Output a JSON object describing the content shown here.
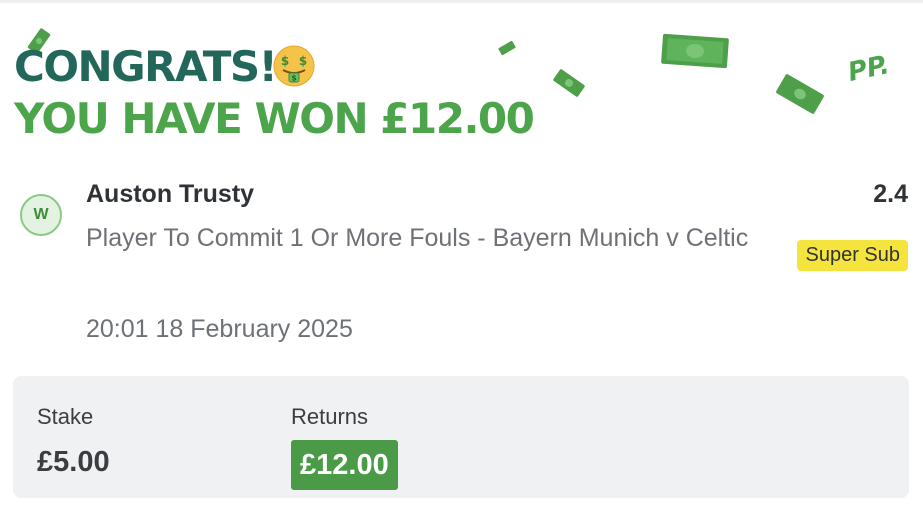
{
  "header": {
    "congrats_text": "CONGRATS!",
    "won_text": "YOU HAVE WON £12.00",
    "emoji_icon": "money-mouth-face",
    "brand_mark": "PP."
  },
  "bet": {
    "status_letter": "W",
    "selection": "Auston Trusty",
    "market": "Player To Commit 1 Or More Fouls - Bayern Munich v Celtic",
    "odds": "2.4",
    "badge": "Super Sub",
    "datetime": "20:01 18 February 2025"
  },
  "summary": {
    "stake_label": "Stake",
    "stake_value": "£5.00",
    "returns_label": "Returns",
    "returns_value": "£12.00"
  },
  "colors": {
    "dark_green": "#23665a",
    "bright_green": "#4ca44b",
    "badge_yellow": "#f5e33e",
    "returns_green": "#4a9a47"
  }
}
